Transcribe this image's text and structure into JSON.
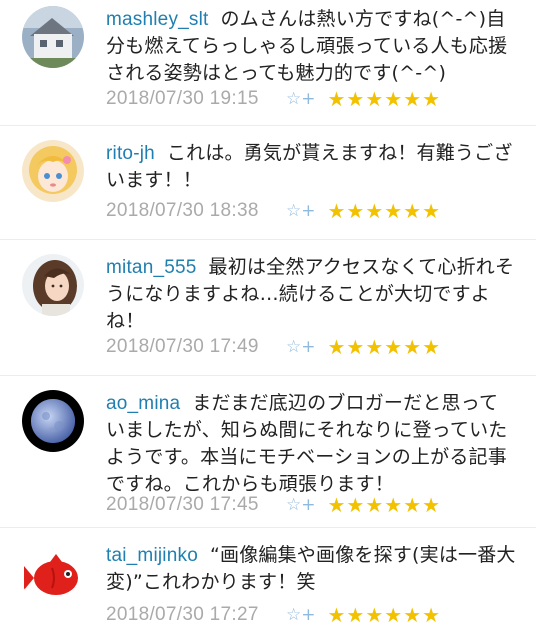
{
  "comments": [
    {
      "user": "mashley_slt",
      "text": "のムさんは熱い方ですね(^-^)自分も燃えてらっしゃるし頑張っている人も応援される姿勢はとっても魅力的です(^-^)",
      "time": "2018/07/30 19:15",
      "star_add_icon": "☆+",
      "stars": "★★★★★★",
      "avatar": "house-photo-avatar"
    },
    {
      "user": "rito-jh",
      "text": "これは。勇気が貰えますね！有難うございます！！",
      "time": "2018/07/30 18:38",
      "star_add_icon": "☆+",
      "stars": "★★★★★★",
      "avatar": "anime-girl-avatar"
    },
    {
      "user": "mitan_555",
      "text": "最初は全然アクセスなくて心折れそうになりますよね…続けることが大切ですよね！",
      "time": "2018/07/30 17:49",
      "star_add_icon": "☆+",
      "stars": "★★★★★★",
      "avatar": "woman-portrait-avatar"
    },
    {
      "user": "ao_mina",
      "text": "まだまだ底辺のブロガーだと思っていましたが、知らぬ間にそれなりに登っていたようです。本当にモチベーションの上がる記事ですね。これからも頑張ります！",
      "time": "2018/07/30 17:45",
      "star_add_icon": "☆+",
      "stars": "★★★★★★",
      "avatar": "moon-avatar"
    },
    {
      "user": "tai_mijinko",
      "text": "“画像編集や画像を探す(実は一番大変)”これわかります！笑",
      "time": "2018/07/30 17:27",
      "star_add_icon": "☆+",
      "stars": "★★★★★★",
      "avatar": "red-fish-avatar"
    }
  ]
}
